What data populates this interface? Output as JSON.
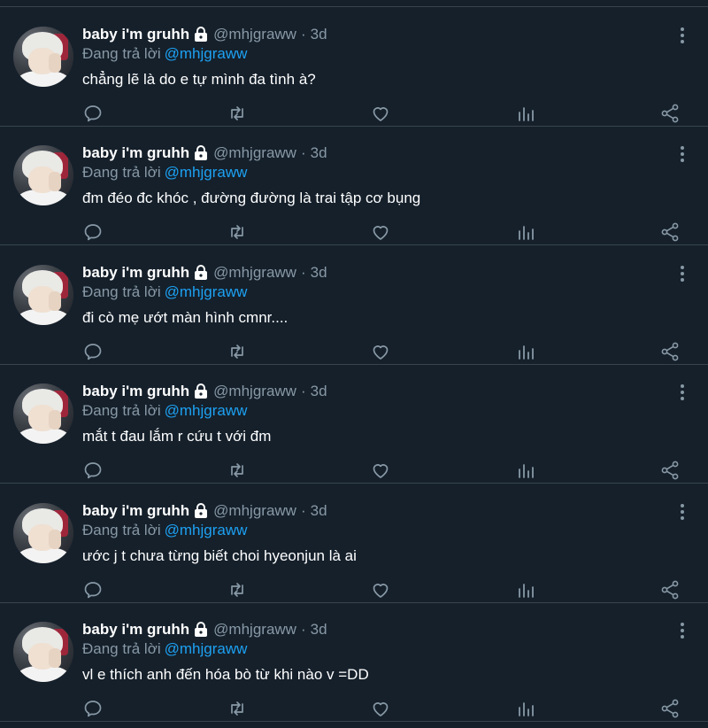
{
  "tweets": [
    {
      "display_name": "baby i'm gruhh",
      "handle": "@mhjgraww",
      "separator": "·",
      "time": "3d",
      "replying_prefix": "Đang trả lời",
      "replying_to": "@mhjgraww",
      "text": "chẳng lẽ là do e tự mình đa tình à?"
    },
    {
      "display_name": "baby i'm gruhh",
      "handle": "@mhjgraww",
      "separator": "·",
      "time": "3d",
      "replying_prefix": "Đang trả lời",
      "replying_to": "@mhjgraww",
      "text": "đm đéo đc khóc , đường đường là trai tập cơ bụng"
    },
    {
      "display_name": "baby i'm gruhh",
      "handle": "@mhjgraww",
      "separator": "·",
      "time": "3d",
      "replying_prefix": "Đang trả lời",
      "replying_to": "@mhjgraww",
      "text": "đi cò mẹ ướt màn hình cmnr...."
    },
    {
      "display_name": "baby i'm gruhh",
      "handle": "@mhjgraww",
      "separator": "·",
      "time": "3d",
      "replying_prefix": "Đang trả lời",
      "replying_to": "@mhjgraww",
      "text": "mắt t đau lắm r cứu t với đm"
    },
    {
      "display_name": "baby i'm gruhh",
      "handle": "@mhjgraww",
      "separator": "·",
      "time": "3d",
      "replying_prefix": "Đang trả lời",
      "replying_to": "@mhjgraww",
      "text": "ước j t chưa từng biết choi hyeonjun là ai"
    },
    {
      "display_name": "baby i'm gruhh",
      "handle": "@mhjgraww",
      "separator": "·",
      "time": "3d",
      "replying_prefix": "Đang trả lời",
      "replying_to": "@mhjgraww",
      "text": "vl e thích anh đến hóa bò từ khi nào v =DD"
    }
  ],
  "icons": {
    "lock": "lock-icon",
    "more": "more-vertical-icon",
    "reply": "reply-icon",
    "retweet": "retweet-icon",
    "like": "heart-icon",
    "stats": "stats-icon",
    "share": "share-icon"
  },
  "colors": {
    "background": "#15202b",
    "divider": "#38444d",
    "text_primary": "#ffffff",
    "text_secondary": "#8899a6",
    "mention": "#1da1f2"
  }
}
